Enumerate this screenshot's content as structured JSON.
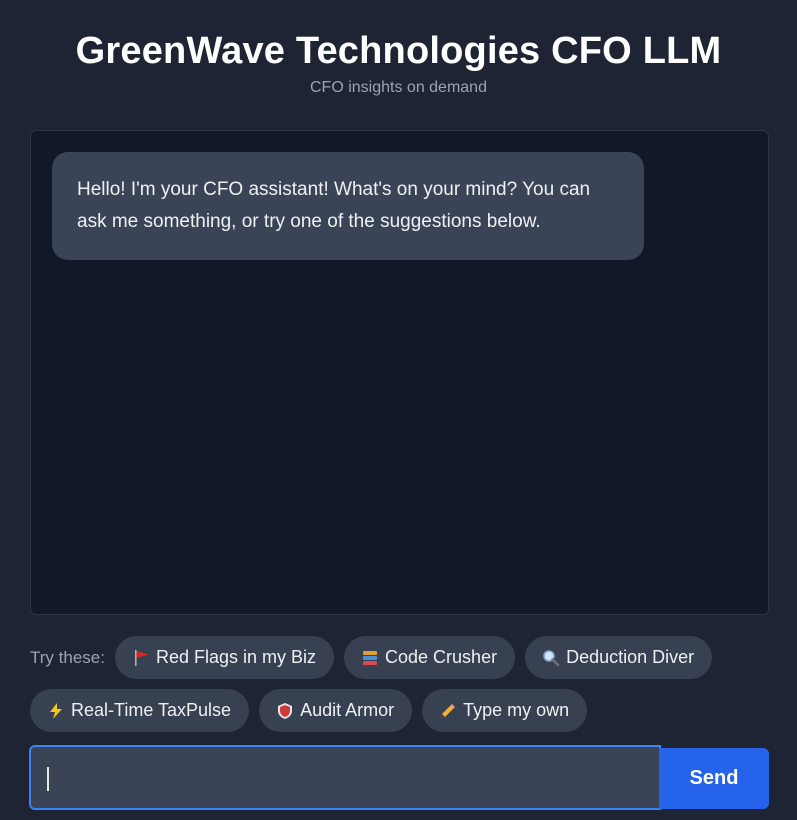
{
  "header": {
    "title": "GreenWave Technologies CFO LLM",
    "subtitle": "CFO insights on demand"
  },
  "chat": {
    "messages": [
      {
        "role": "assistant",
        "text": "Hello! I'm your CFO assistant! What's on your mind? You can ask me something, or try one of the suggestions below."
      }
    ]
  },
  "suggestions": {
    "label": "Try these:",
    "chips": [
      {
        "icon": "red-flag-icon",
        "emoji": "🚩",
        "label": "Red Flags in my Biz"
      },
      {
        "icon": "books-icon",
        "emoji": "📚",
        "label": "Code Crusher"
      },
      {
        "icon": "magnifier-icon",
        "emoji": "🔍",
        "label": "Deduction Diver"
      },
      {
        "icon": "lightning-icon",
        "emoji": "⚡",
        "label": "Real-Time TaxPulse"
      },
      {
        "icon": "shield-icon",
        "emoji": "🛡",
        "label": "Audit Armor"
      },
      {
        "icon": "pencil-icon",
        "emoji": "✏",
        "label": "Type my own"
      }
    ]
  },
  "composer": {
    "input_value": "",
    "send_label": "Send"
  },
  "colors": {
    "background": "#1e2433",
    "chat_panel": "#111827",
    "bubble": "#3a4456",
    "chip": "#374151",
    "accent": "#2563eb",
    "focus_border": "#3b82f6"
  }
}
